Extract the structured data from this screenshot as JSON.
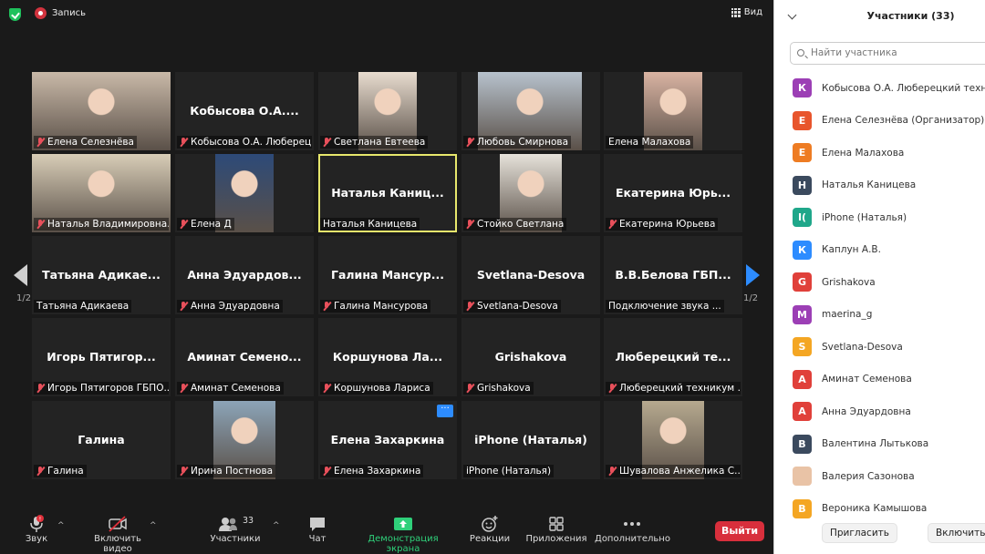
{
  "topbar": {
    "record_label": "Запись",
    "view_label": "Вид"
  },
  "tiles": [
    {
      "big": "",
      "name": "Елена Селезнёва",
      "muted": true
    },
    {
      "big": "Кобысова О.А....",
      "name": "Кобысова О.А. Люберецк...",
      "muted": true
    },
    {
      "big": "",
      "name": "Светлана Евтеева",
      "muted": true
    },
    {
      "big": "",
      "name": "Любовь Смирнова",
      "muted": true
    },
    {
      "big": "",
      "name": "Елена Малахова",
      "muted": false
    },
    {
      "big": "",
      "name": "Наталья Владимировна...",
      "muted": true
    },
    {
      "big": "",
      "name": "Елена Д",
      "muted": true
    },
    {
      "big": "Наталья  Каниц...",
      "name": "Наталья Каницева",
      "muted": false
    },
    {
      "big": "",
      "name": "Стойко Светлана",
      "muted": true
    },
    {
      "big": "Екатерина  Юрь...",
      "name": "Екатерина Юрьева",
      "muted": true
    },
    {
      "big": "Татьяна  Адикае...",
      "name": "Татьяна Адикаева",
      "muted": false
    },
    {
      "big": "Анна  Эдуардов...",
      "name": "Анна Эдуардовна",
      "muted": true
    },
    {
      "big": "Галина  Мансур...",
      "name": "Галина Мансурова",
      "muted": true
    },
    {
      "big": "Svetlana-Desova",
      "name": "Svetlana-Desova",
      "muted": true
    },
    {
      "big": "В.В.Белова  ГБП...",
      "name": "Подключение звука ...",
      "muted": false
    },
    {
      "big": "Игорь  Пятигор...",
      "name": "Игорь Пятигоров ГБПО...",
      "muted": true
    },
    {
      "big": "Аминат  Семено...",
      "name": "Аминат Семенова",
      "muted": true
    },
    {
      "big": "Коршунова  Ла...",
      "name": "Коршунова Лариса",
      "muted": true
    },
    {
      "big": "Grishakova",
      "name": "Grishakova",
      "muted": true
    },
    {
      "big": "Люберецкий  те...",
      "name": "Люберецкий техникум ...",
      "muted": true
    },
    {
      "big": "Галина",
      "name": "Галина",
      "muted": true
    },
    {
      "big": "",
      "name": "Ирина Постнова",
      "muted": true
    },
    {
      "big": "Елена Захаркина",
      "name": "Елена Захаркина",
      "muted": true
    },
    {
      "big": "iPhone (Наталья)",
      "name": "iPhone (Наталья)",
      "muted": false
    },
    {
      "big": "",
      "name": "Шувалова Анжелика С...",
      "muted": true
    }
  ],
  "pager": {
    "left": "1/2",
    "right": "1/2"
  },
  "toolbar": {
    "audio": "Звук",
    "video": "Включить видео",
    "participants": "Участники",
    "participants_count": "33",
    "chat": "Чат",
    "share": "Демонстрация экрана",
    "reactions": "Реакции",
    "apps": "Приложения",
    "more": "Дополнительно",
    "leave": "Выйти"
  },
  "panel": {
    "title": "Участники (33)",
    "search_placeholder": "Найти участника",
    "invite": "Пригласить",
    "unmute": "Включить"
  },
  "participants": [
    {
      "initial": "К",
      "color": "#9c3fb5",
      "name": "Кобысова О.А. Люберецкий техн. г"
    },
    {
      "initial": "Е",
      "color": "#e8552c",
      "name": "Елена Селезнёва (Организатор)"
    },
    {
      "initial": "Е",
      "color": "#ee7c23",
      "name": "Елена Малахова"
    },
    {
      "initial": "Н",
      "color": "#3b4a5e",
      "name": "Наталья Каницева"
    },
    {
      "initial": "I(",
      "color": "#1fa78a",
      "name": "iPhone (Наталья)"
    },
    {
      "initial": "К",
      "color": "#2d8cff",
      "name": "Каплун А.В."
    },
    {
      "initial": "G",
      "color": "#e0403a",
      "name": "Grishakova"
    },
    {
      "initial": "M",
      "color": "#9c3fb5",
      "name": "maerina_g"
    },
    {
      "initial": "S",
      "color": "#f4a623",
      "name": "Svetlana-Desova"
    },
    {
      "initial": "А",
      "color": "#e0403a",
      "name": "Аминат Семенова"
    },
    {
      "initial": "А",
      "color": "#e0403a",
      "name": "Анна Эдуардовна"
    },
    {
      "initial": "В",
      "color": "#3b4a5e",
      "name": "Валентина Лытькова"
    },
    {
      "initial": "",
      "color": "#e9c3a6",
      "name": "Валерия Сазонова"
    },
    {
      "initial": "В",
      "color": "#f4a623",
      "name": "Вероника Камышова"
    }
  ]
}
